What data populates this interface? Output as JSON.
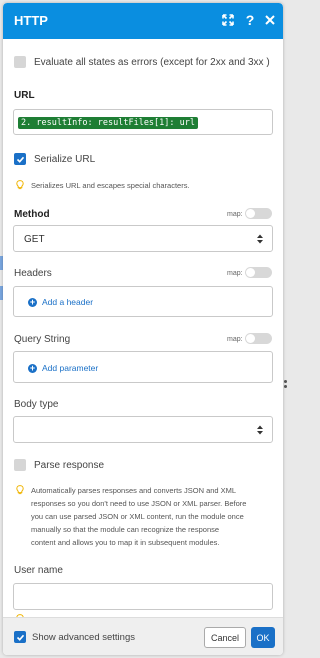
{
  "header": {
    "title": "HTTP",
    "expand_icon": "expand-icon",
    "help_icon": "?",
    "close_icon": "close-icon",
    "background": "#0a8ee0"
  },
  "evaluate_errors": {
    "label": "Evaluate all states as errors (except for 2xx and 3xx )",
    "checked": false
  },
  "url": {
    "label": "URL",
    "value": "2. resultInfo: resultFiles[1]: url"
  },
  "serialize_url": {
    "label": "Serialize URL",
    "checked": true,
    "hint": "Serializes URL and escapes special characters."
  },
  "method": {
    "label": "Method",
    "map_label": "map:",
    "value": "GET"
  },
  "headers": {
    "label": "Headers",
    "map_label": "map:",
    "add_label": "Add a header"
  },
  "query_string": {
    "label": "Query String",
    "map_label": "map:",
    "add_label": "Add parameter"
  },
  "body_type": {
    "label": "Body type",
    "value": ""
  },
  "parse_response": {
    "label": "Parse response",
    "checked": false,
    "hint_lines": [
      "Automatically parses responses and converts JSON and XML",
      "responses so you don't need to use JSON or XML parser. Before",
      "you can use parsed JSON or XML content, run the module once",
      "manually so that the module can recognize the response",
      "content and allows you to map it in subsequent modules."
    ]
  },
  "user_name": {
    "label": "User name",
    "value": ""
  },
  "footer": {
    "show_advanced_label": "Show advanced settings",
    "show_advanced_checked": true,
    "cancel_label": "Cancel",
    "ok_label": "OK"
  },
  "colors": {
    "accent": "#1a70c7",
    "url_pill": "#1e7e34",
    "hint_bulb": "#f0b400"
  }
}
